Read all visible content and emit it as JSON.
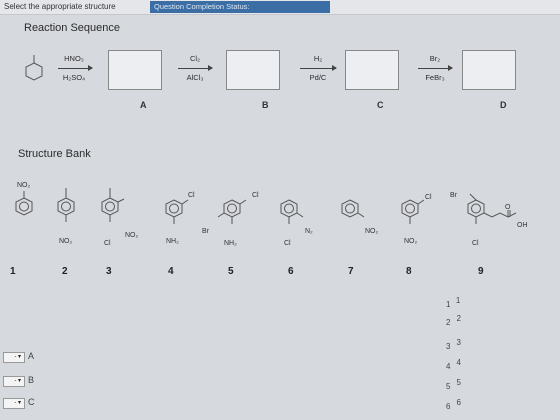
{
  "header": {
    "instruction": "Select the appropriate structure",
    "status": "Question Completion Status:"
  },
  "reaction": {
    "title": "Reaction Sequence",
    "steps": [
      {
        "top": "HNO₃",
        "bottom": "H₂SO₄"
      },
      {
        "top": "Cl₂",
        "bottom": "AlCl₃"
      },
      {
        "top": "H₂",
        "bottom": "Pd/C"
      },
      {
        "top": "Br₂",
        "bottom": "FeBr₃"
      }
    ],
    "slots": [
      "A",
      "B",
      "C",
      "D"
    ]
  },
  "bank": {
    "title": "Structure Bank",
    "substituents": {
      "s1": "NO₂",
      "s2": "NO₂",
      "s3_a": "NO₂",
      "s3_b": "Cl",
      "s4_a": "Cl",
      "s4_b": "NH₂",
      "s5_a": "Cl",
      "s5_b": "Br",
      "s5_c": "NH₂",
      "s6_a": "N₂",
      "s6_b": "Cl",
      "s7": "NO₂",
      "s8_a": "Cl",
      "s8_b": "NO₂",
      "s9_a": "Br",
      "s9_b": "O",
      "s9_c": "OH",
      "s9_d": "Cl"
    },
    "numbers": [
      "1",
      "2",
      "3",
      "4",
      "5",
      "6",
      "7",
      "8",
      "9"
    ]
  },
  "options": [
    {
      "main": "1",
      "sub": "1"
    },
    {
      "main": "2",
      "sub": "2"
    },
    {
      "main": "3",
      "sub": "3"
    },
    {
      "main": "4",
      "sub": "4"
    },
    {
      "main": "5",
      "sub": "5"
    },
    {
      "main": "6",
      "sub": "6"
    }
  ],
  "answers": [
    {
      "label": "A",
      "dropdown": "- ▾"
    },
    {
      "label": "B",
      "dropdown": "- ▾"
    },
    {
      "label": "C",
      "dropdown": "- ▾"
    }
  ]
}
